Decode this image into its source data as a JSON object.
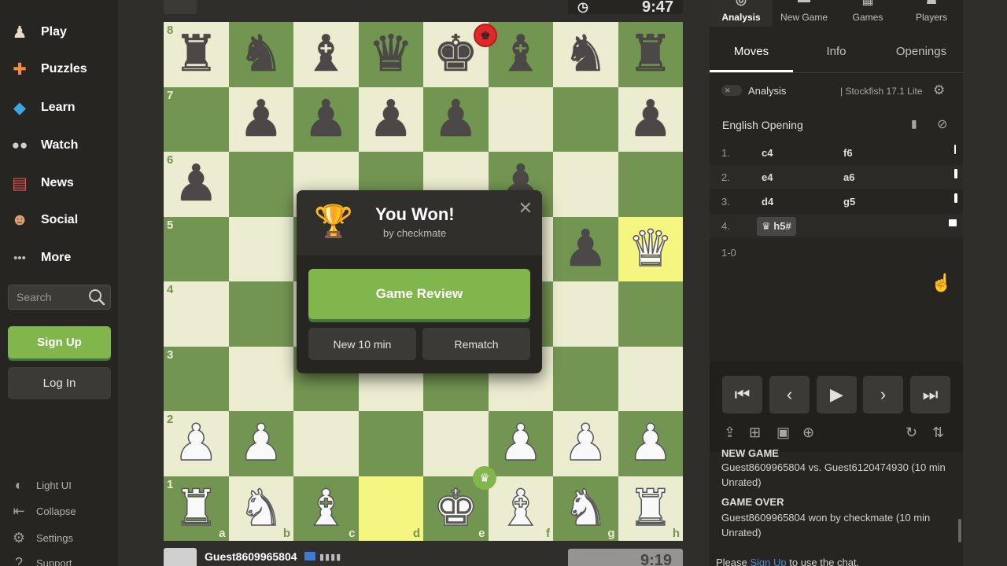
{
  "sidebar": {
    "items": [
      {
        "label": "Play",
        "icon": "pawn-play-icon"
      },
      {
        "label": "Puzzles",
        "icon": "puzzle-icon"
      },
      {
        "label": "Learn",
        "icon": "graduation-cap-icon"
      },
      {
        "label": "Watch",
        "icon": "binoculars-icon"
      },
      {
        "label": "News",
        "icon": "newspaper-icon"
      },
      {
        "label": "Social",
        "icon": "people-icon"
      },
      {
        "label": "More",
        "icon": "dots-icon"
      }
    ],
    "search_placeholder": "Search",
    "signup_label": "Sign Up",
    "login_label": "Log In",
    "bottom_items": [
      {
        "label": "Light UI",
        "icon": "half-circle-icon"
      },
      {
        "label": "Collapse",
        "icon": "collapse-arrow-icon"
      },
      {
        "label": "Settings",
        "icon": "gear-icon"
      },
      {
        "label": "Support",
        "icon": "help-icon"
      }
    ]
  },
  "board": {
    "top_clock": "9:47",
    "ranks": [
      "8",
      "7",
      "6",
      "5",
      "4",
      "3",
      "2",
      "1"
    ],
    "files": [
      "a",
      "b",
      "c",
      "d",
      "e",
      "f",
      "g",
      "h"
    ],
    "pieces": [
      {
        "sq": "a8",
        "glyph": "♜",
        "color": "b"
      },
      {
        "sq": "b8",
        "glyph": "♞",
        "color": "b"
      },
      {
        "sq": "c8",
        "glyph": "♝",
        "color": "b"
      },
      {
        "sq": "d8",
        "glyph": "♛",
        "color": "b"
      },
      {
        "sq": "e8",
        "glyph": "♚",
        "color": "b"
      },
      {
        "sq": "f8",
        "glyph": "♝",
        "color": "b"
      },
      {
        "sq": "g8",
        "glyph": "♞",
        "color": "b"
      },
      {
        "sq": "h8",
        "glyph": "♜",
        "color": "b"
      },
      {
        "sq": "b7",
        "glyph": "♟",
        "color": "b"
      },
      {
        "sq": "c7",
        "glyph": "♟",
        "color": "b"
      },
      {
        "sq": "d7",
        "glyph": "♟",
        "color": "b"
      },
      {
        "sq": "e7",
        "glyph": "♟",
        "color": "b"
      },
      {
        "sq": "h7",
        "glyph": "♟",
        "color": "b"
      },
      {
        "sq": "a6",
        "glyph": "♟",
        "color": "b"
      },
      {
        "sq": "f6",
        "glyph": "♟",
        "color": "b"
      },
      {
        "sq": "g5",
        "glyph": "♟",
        "color": "b"
      },
      {
        "sq": "h5",
        "glyph": "♛",
        "color": "w"
      },
      {
        "sq": "a2",
        "glyph": "♟",
        "color": "w"
      },
      {
        "sq": "b2",
        "glyph": "♟",
        "color": "w"
      },
      {
        "sq": "f2",
        "glyph": "♟",
        "color": "w"
      },
      {
        "sq": "g2",
        "glyph": "♟",
        "color": "w"
      },
      {
        "sq": "h2",
        "glyph": "♟",
        "color": "w"
      },
      {
        "sq": "a1",
        "glyph": "♜",
        "color": "w"
      },
      {
        "sq": "b1",
        "glyph": "♞",
        "color": "w"
      },
      {
        "sq": "c1",
        "glyph": "♝",
        "color": "w"
      },
      {
        "sq": "e1",
        "glyph": "♚",
        "color": "w"
      },
      {
        "sq": "f1",
        "glyph": "♝",
        "color": "w"
      },
      {
        "sq": "g1",
        "glyph": "♞",
        "color": "w"
      },
      {
        "sq": "h1",
        "glyph": "♜",
        "color": "w"
      }
    ],
    "highlight_squares": [
      "d1",
      "h5"
    ],
    "light_color": "#ebecd0",
    "dark_color": "#739552",
    "highlight_color": "#f5f682"
  },
  "modal": {
    "title": "You Won!",
    "subtitle": "by checkmate",
    "review_label": "Game Review",
    "new_game_label": "New 10 min",
    "rematch_label": "Rematch"
  },
  "bottom_player": {
    "name": "Guest8609965804",
    "clock": "9:19"
  },
  "panel": {
    "top_tabs": [
      "Analysis",
      "New Game",
      "Games",
      "Players"
    ],
    "sub_tabs": [
      "Moves",
      "Info",
      "Openings"
    ],
    "analysis_label": "Analysis",
    "engine": "Stockfish 17.1 Lite",
    "opening": "English Opening",
    "moves": [
      {
        "num": "1.",
        "white": "c4",
        "black": "f6"
      },
      {
        "num": "2.",
        "white": "e4",
        "black": "a6"
      },
      {
        "num": "3.",
        "white": "d4",
        "black": "g5"
      },
      {
        "num": "4.",
        "white": "h5#",
        "black": ""
      }
    ],
    "result": "1-0",
    "log": {
      "new_game_head": "NEW GAME",
      "new_game_text": "Guest8609965804 vs. Guest6120474930 (10 min Unrated)",
      "over_head": "GAME OVER",
      "over_text": "Guest8609965804 won by checkmate (10 min Unrated)"
    },
    "chat_prefix": "Please",
    "chat_link": "Sign Up",
    "chat_suffix": "to use the chat."
  }
}
